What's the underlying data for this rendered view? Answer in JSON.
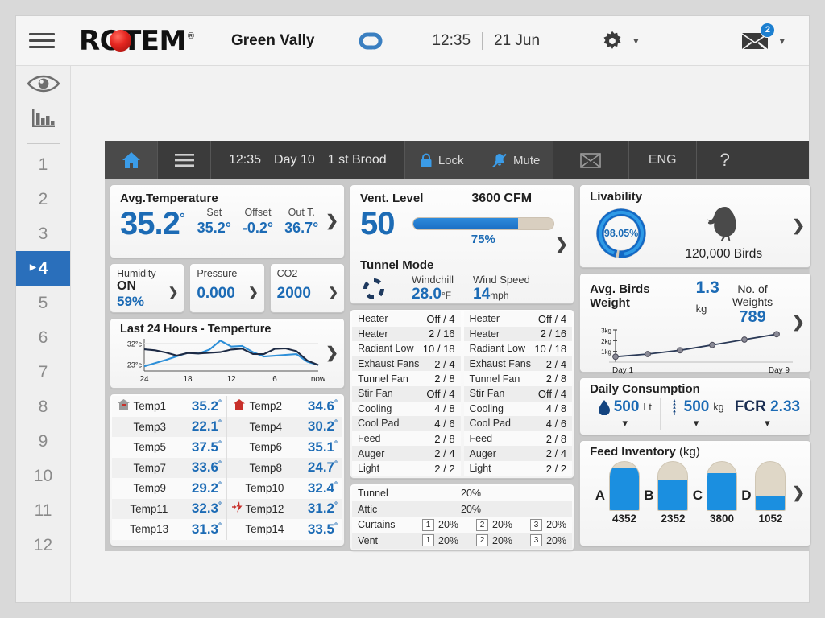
{
  "header": {
    "logo_text": "ROTEM",
    "logo_registered": "®",
    "farm_name": "Green Vally",
    "time": "12:35",
    "date": "21 Jun",
    "mail_badge": "2"
  },
  "rail": {
    "items": [
      "1",
      "2",
      "3",
      "4",
      "5",
      "6",
      "7",
      "8",
      "9",
      "10",
      "11",
      "12"
    ],
    "active": "4"
  },
  "toolbar": {
    "time": "12:35",
    "day": "Day 10",
    "brood": "1 st  Brood",
    "lock": "Lock",
    "mute": "Mute",
    "lang": "ENG",
    "help": "?"
  },
  "avg_temperature": {
    "title": "Avg.Temperature",
    "value": "35.2",
    "deg": "°",
    "set_label": "Set",
    "set_value": "35.2°",
    "offset_label": "Offset",
    "offset_value": "-0.2°",
    "out_label": "Out T.",
    "out_value": "36.7°"
  },
  "trio": {
    "humidity_label": "Humidity",
    "humidity_state": "ON",
    "humidity_value": "59%",
    "pressure_label": "Pressure",
    "pressure_value": "0.000",
    "co2_label": "CO2",
    "co2_value": "2000"
  },
  "vent": {
    "title": "Vent. Level",
    "cfm": "3600 CFM",
    "level": "50",
    "percent_label": "75%",
    "percent": 75,
    "tunnel_title": "Tunnel Mode",
    "windchill_label": "Windchill",
    "windchill_value": "28.0",
    "windchill_unit": "°F",
    "windspeed_label": "Wind Speed",
    "windspeed_value": "14",
    "windspeed_unit": "mph"
  },
  "livability": {
    "title": "Livability",
    "percent": "98.05%",
    "birds": "120,000 Birds"
  },
  "bird_weight": {
    "title": "Avg. Birds Weight",
    "value": "1.3",
    "unit": "kg",
    "count_label": "No. of Weights",
    "count_value": "789",
    "y_ticks": [
      "3kg",
      "2kg",
      "1kg"
    ],
    "x_start": "Day 1",
    "x_end": "Day 9"
  },
  "daily_consumption": {
    "title": "Daily Consumption",
    "water_value": "500",
    "water_unit": "Lt",
    "feed_value": "500",
    "feed_unit": "kg",
    "fcr_label": "FCR",
    "fcr_value": "2.33"
  },
  "feed_inventory": {
    "title_main": "Feed Inventory",
    "title_unit": "(kg)",
    "silos": [
      {
        "letter": "A",
        "value": "4352",
        "fill_pct": 88
      },
      {
        "letter": "B",
        "value": "2352",
        "fill_pct": 62
      },
      {
        "letter": "C",
        "value": "3800",
        "fill_pct": 76
      },
      {
        "letter": "D",
        "value": "1052",
        "fill_pct": 30
      }
    ]
  },
  "temp_sensors": [
    {
      "name": "Temp1",
      "value": "35.2",
      "icon": "house-gray-icon"
    },
    {
      "name": "Temp2",
      "value": "34.6",
      "icon": "house-red-icon"
    },
    {
      "name": "Temp3",
      "value": "22.1",
      "icon": ""
    },
    {
      "name": "Temp4",
      "value": "30.2",
      "icon": ""
    },
    {
      "name": "Temp5",
      "value": "37.5",
      "icon": ""
    },
    {
      "name": "Temp6",
      "value": "35.1",
      "icon": ""
    },
    {
      "name": "Temp7",
      "value": "33.6",
      "icon": ""
    },
    {
      "name": "Temp8",
      "value": "24.7",
      "icon": ""
    },
    {
      "name": "Temp9",
      "value": "29.2",
      "icon": ""
    },
    {
      "name": "Temp10",
      "value": "32.4",
      "icon": ""
    },
    {
      "name": "Temp11",
      "value": "32.3",
      "icon": ""
    },
    {
      "name": "Temp12",
      "value": "31.2",
      "icon": "alarm-red-icon"
    },
    {
      "name": "Temp13",
      "value": "31.3",
      "icon": ""
    },
    {
      "name": "Temp14",
      "value": "33.5",
      "icon": ""
    }
  ],
  "devices": [
    {
      "name": "Heater",
      "value": "Off / 4"
    },
    {
      "name": "Heater",
      "value": "2 / 16"
    },
    {
      "name": "Radiant Low",
      "value": "10 / 18"
    },
    {
      "name": "Exhaust Fans",
      "value": "2 / 4"
    },
    {
      "name": "Tunnel Fan",
      "value": "2 / 8"
    },
    {
      "name": "Stir Fan",
      "value": "Off / 4"
    },
    {
      "name": "Cooling",
      "value": "4 / 8"
    },
    {
      "name": "Cool Pad",
      "value": "4 / 6"
    },
    {
      "name": "Feed",
      "value": "2 / 8"
    },
    {
      "name": "Auger",
      "value": "2 / 4"
    },
    {
      "name": "Light",
      "value": "2 / 2"
    }
  ],
  "openings": [
    {
      "name": "Tunnel",
      "single": "20%",
      "items": []
    },
    {
      "name": "Attic",
      "single": "20%",
      "items": []
    },
    {
      "name": "Curtains",
      "single": "",
      "items": [
        {
          "n": "1",
          "v": "20%"
        },
        {
          "n": "2",
          "v": "20%"
        },
        {
          "n": "3",
          "v": "20%"
        }
      ]
    },
    {
      "name": "Vent",
      "single": "",
      "items": [
        {
          "n": "1",
          "v": "20%"
        },
        {
          "n": "2",
          "v": "20%"
        },
        {
          "n": "3",
          "v": "20%"
        }
      ]
    }
  ],
  "chart_data": [
    {
      "type": "line",
      "title": "Last 24 Hours - Temperture",
      "xlabel": "",
      "ylabel": "",
      "ylim": [
        20,
        34
      ],
      "y_ticks": [
        "32°c",
        "23°c"
      ],
      "x_ticks": [
        "24",
        "18",
        "12",
        "6",
        "now"
      ],
      "x": [
        24,
        22.5,
        21,
        19.5,
        18,
        16.5,
        15,
        13.5,
        12,
        10.5,
        9,
        7.5,
        6,
        4.5,
        3,
        1.5,
        0
      ],
      "series": [
        {
          "name": "inside-temp",
          "color": "#2d8fd8",
          "values": [
            22.0,
            23.4,
            24.8,
            26.4,
            27.9,
            27.6,
            29.3,
            33.2,
            30.6,
            30.9,
            28.2,
            26.3,
            26.6,
            27.0,
            27.3,
            24.0,
            22.6
          ]
        },
        {
          "name": "target-temp",
          "color": "#1d2a44",
          "values": [
            29.4,
            29.0,
            28.0,
            26.7,
            27.8,
            27.6,
            27.9,
            28.2,
            29.3,
            29.7,
            27.4,
            27.3,
            29.6,
            29.8,
            28.6,
            24.5,
            22.6
          ]
        }
      ],
      "legend_position": "none",
      "grid": false
    },
    {
      "type": "line",
      "title": "Avg. Birds Weight",
      "xlabel": "",
      "ylabel": "kg",
      "ylim": [
        0,
        3
      ],
      "y_ticks": [
        "1kg",
        "2kg",
        "3kg"
      ],
      "x_ticks": [
        "Day 1",
        "Day 9"
      ],
      "x": [
        "Day 1",
        "Day 2.5",
        "Day 4",
        "Day 5.5",
        "Day 7",
        "Day 9"
      ],
      "values": [
        0.5,
        0.75,
        1.1,
        1.6,
        2.1,
        2.6
      ],
      "color": "#2b3a57",
      "marker": "circle",
      "grid": false,
      "legend_position": "none"
    },
    {
      "type": "bar",
      "title": "Feed Inventory (kg)",
      "categories": [
        "A",
        "B",
        "C",
        "D"
      ],
      "values": [
        4352,
        2352,
        3800,
        1052
      ],
      "xlabel": "",
      "ylabel": "kg",
      "ylim": [
        0,
        5000
      ],
      "grid": false,
      "legend_position": "none"
    }
  ]
}
